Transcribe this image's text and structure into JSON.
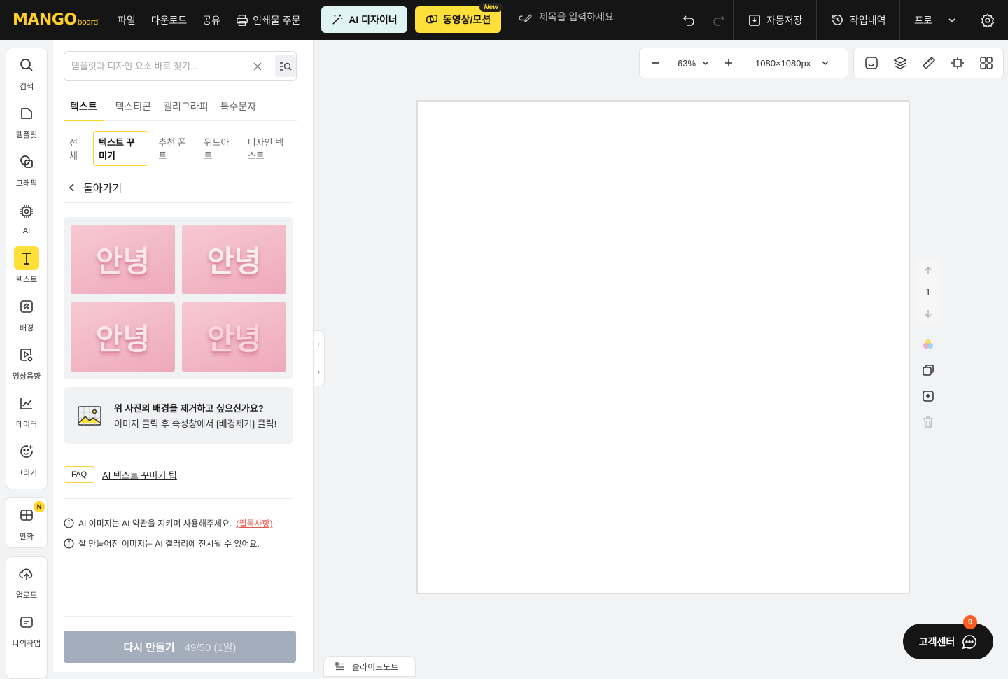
{
  "app": {
    "logo_main": "MANGO",
    "logo_sub": "board",
    "menu": [
      "파일",
      "다운로드",
      "공유",
      "인쇄물 주문"
    ],
    "ai_designer_label": "AI 디자이너",
    "video_label": "동영상/모션",
    "new_badge": "New",
    "title_placeholder": "제목을 입력하세요",
    "autosave_label": "자동저장",
    "history_label": "작업내역",
    "plan_label": "프로"
  },
  "rail": {
    "items": [
      "검색",
      "템플릿",
      "그래픽",
      "AI",
      "텍스트",
      "배경",
      "영상음향",
      "데이터",
      "그리기"
    ],
    "comic_label": "만화",
    "comic_badge": "N",
    "upload_label": "업로드",
    "mywork_label": "나의작업"
  },
  "panel": {
    "search_placeholder": "템플릿과 디자인 요소 바로 찾기...",
    "tabs": [
      "텍스트",
      "텍스티콘",
      "캘리그라피",
      "특수문자"
    ],
    "chips": [
      "전체",
      "텍스트 꾸미기",
      "추천 폰트",
      "워드아트",
      "디자인 텍스트"
    ],
    "back_label": "돌아가기",
    "thumb_text": "안녕",
    "bg_remove_title": "위 사진의 배경을 제거하고 싶으신가요?",
    "bg_remove_desc": "이미지 클릭 후 속성창에서 [배경제거] 클릭!",
    "faq_badge": "FAQ",
    "faq_link": "AI 텍스트 꾸미기 팁",
    "note1": "AI 이미지는 AI 약관을 지키며 사용해주세요.",
    "note1_link": "(필독사항)",
    "note2": "잘 만들어진 이미지는 AI 갤러리에 전시될 수 있어요.",
    "regen_label": "다시 만들기",
    "regen_count": "49/50 (1일)"
  },
  "editor": {
    "zoom": "63%",
    "size": "1080×1080px",
    "page_number": "1",
    "help_label": "고객센터",
    "help_badge": "9",
    "slide_note": "슬라이드노트"
  },
  "colors": {
    "accent_yellow": "#ffe03b",
    "topbar": "#151515",
    "ai_button": "#dff4f3",
    "regen_button": "#a3adbc",
    "alert_red": "#e2584f"
  }
}
